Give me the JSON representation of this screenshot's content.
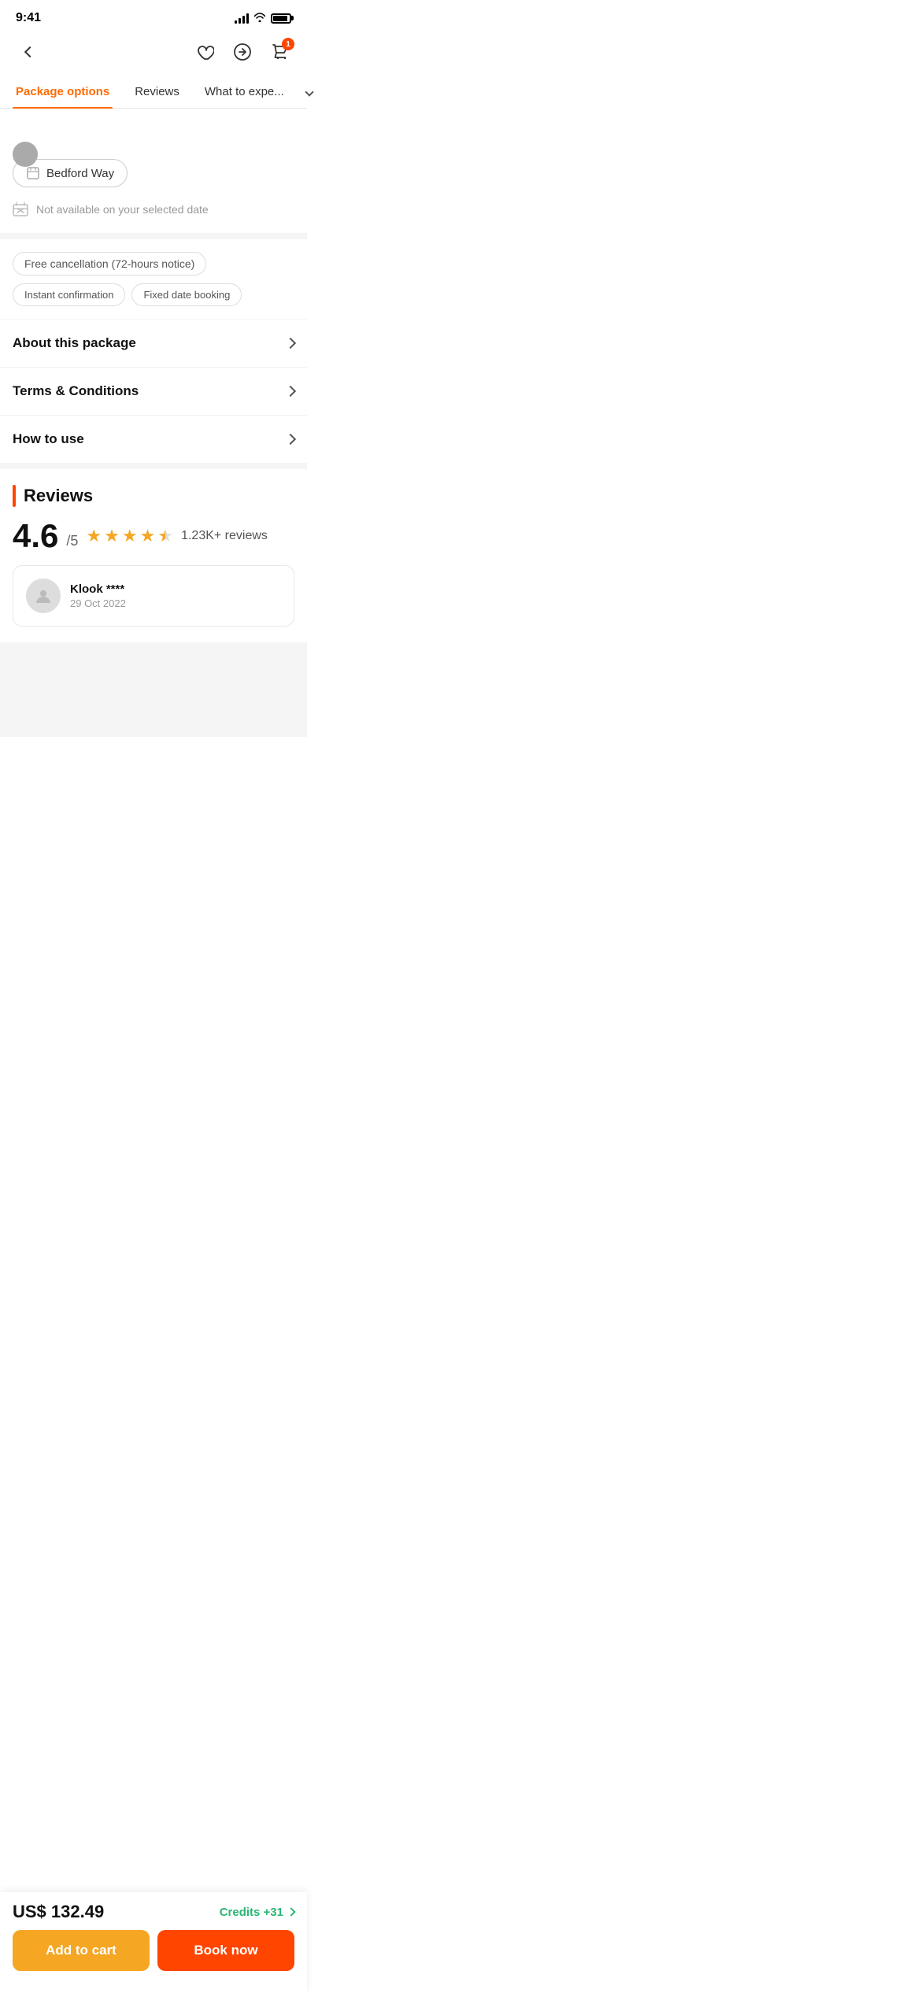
{
  "statusBar": {
    "time": "9:41",
    "cartBadge": "1"
  },
  "nav": {
    "backLabel": "back",
    "heartIcon": "heart",
    "shareIcon": "share",
    "cartIcon": "cart"
  },
  "tabs": [
    {
      "id": "package-options",
      "label": "Package options",
      "active": true
    },
    {
      "id": "reviews",
      "label": "Reviews",
      "active": false
    },
    {
      "id": "what-to-expect",
      "label": "What to expe...",
      "active": false
    }
  ],
  "packageCard": {
    "locationName": "Bedford Way",
    "unavailableText": "Not available on your selected date"
  },
  "infoChips": {
    "cancellation": "Free cancellation (72-hours notice)",
    "chip1": "Instant confirmation",
    "chip2": "Fixed date booking"
  },
  "expandableSections": [
    {
      "label": "About this package"
    },
    {
      "label": "Terms & Conditions"
    },
    {
      "label": "How to use"
    }
  ],
  "reviews": {
    "sectionTitle": "Reviews",
    "score": "4.6",
    "maxScore": "/5",
    "stars": 4.5,
    "reviewCount": "1.23K+ reviews",
    "reviewCard": {
      "reviewerName": "Klook ****",
      "reviewDate": "29 Oct 2022"
    }
  },
  "bottomBar": {
    "price": "US$ 132.49",
    "creditsLabel": "Credits +31",
    "addToCartLabel": "Add to cart",
    "bookNowLabel": "Book now"
  }
}
